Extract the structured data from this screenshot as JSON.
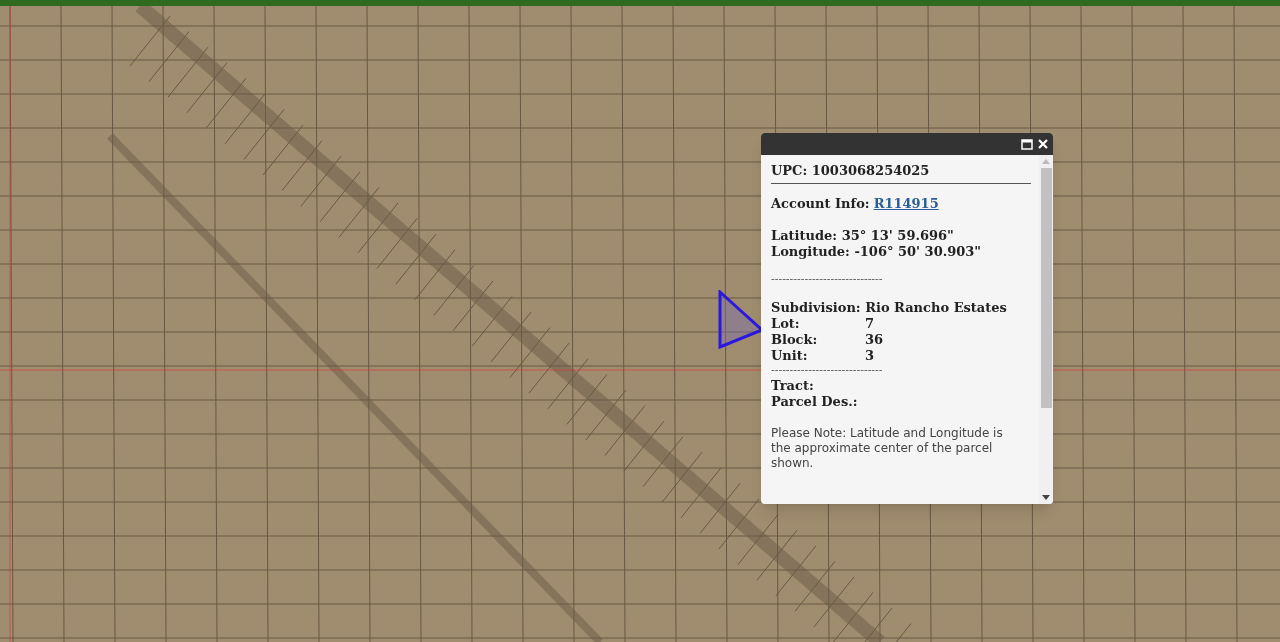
{
  "popup": {
    "upc": "UPC: 1003068254025",
    "account_label": "Account Info:",
    "account_link": "R114915",
    "latitude": "Latitude: 35° 13' 59.696\"",
    "longitude": "Longitude: -106° 50' 30.903\"",
    "separator_1": "------------------------------",
    "subdivision": "Subdivision: Rio Rancho Estates",
    "fields": [
      {
        "label": "Lot:",
        "value": "7"
      },
      {
        "label": "Block:",
        "value": "36"
      },
      {
        "label": "Unit:",
        "value": "3"
      }
    ],
    "separator_2": "------------------------------",
    "tract": "Tract:",
    "parcel_des": "Parcel Des.:",
    "note": "Please Note: Latitude and Longitude is the approximate center of the parcel shown."
  }
}
